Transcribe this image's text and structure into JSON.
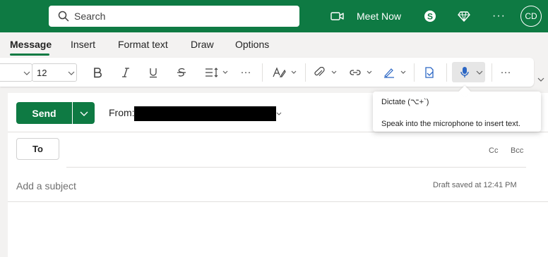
{
  "header": {
    "search_placeholder": "Search",
    "meet_now_label": "Meet Now",
    "more_label": "···",
    "avatar_initials": "CD",
    "bg_color": "#0e7a43",
    "icons": [
      "search-icon",
      "video-icon",
      "skype-icon",
      "premium-diamond-icon",
      "more-icon"
    ]
  },
  "tabs": {
    "items": [
      "Message",
      "Insert",
      "Format text",
      "Draw",
      "Options"
    ],
    "active": "Message"
  },
  "toolbar": {
    "font_size": "12",
    "more_label": "···",
    "more_label_2": "···",
    "icons": [
      "bold-icon",
      "italic-icon",
      "underline-icon",
      "strikethrough-icon",
      "line-spacing-icon",
      "more-icon",
      "styles-icon",
      "attach-icon",
      "link-icon",
      "signature-icon",
      "sensitivity-icon",
      "microphone-icon",
      "more-icon",
      "expand-icon"
    ]
  },
  "compose": {
    "send_label": "Send",
    "from_label": "From:",
    "to_label": "To",
    "cc_label": "Cc",
    "bcc_label": "Bcc",
    "subject_placeholder": "Add a subject",
    "draft_status": "Draft saved at 12:41 PM"
  },
  "tooltip": {
    "title": "Dictate (⌥+`)",
    "description": "Speak into the microphone to insert text."
  }
}
